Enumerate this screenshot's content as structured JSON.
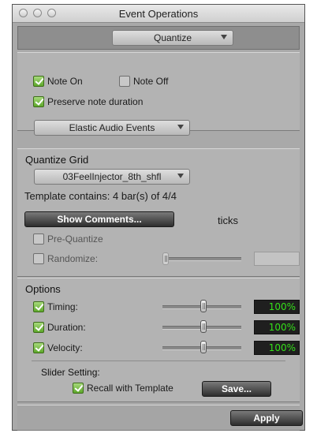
{
  "window": {
    "title": "Event Operations"
  },
  "operation_select": {
    "value": "Quantize"
  },
  "note_options": {
    "note_on": {
      "label": "Note On",
      "checked": true
    },
    "note_off": {
      "label": "Note Off",
      "checked": false
    },
    "preserve_duration": {
      "label": "Preserve note duration",
      "checked": true
    },
    "target_select": {
      "value": "Elastic Audio Events"
    }
  },
  "quantize_grid": {
    "heading": "Quantize Grid",
    "grid_select": {
      "value": "03FeelInjector_8th_shfl"
    },
    "template_info": "Template contains: 4 bar(s) of 4/4",
    "show_comments_label": "Show Comments...",
    "ticks_label": "ticks",
    "pre_quantize": {
      "label": "Pre-Quantize",
      "checked": false
    },
    "randomize": {
      "label": "Randomize:",
      "checked": false,
      "slider_level": 0.0,
      "value": ""
    }
  },
  "options": {
    "heading": "Options",
    "rows": [
      {
        "label": "Timing:",
        "checked": true,
        "value": "100%",
        "slider_level": 1.0
      },
      {
        "label": "Duration:",
        "checked": true,
        "value": "100%",
        "slider_level": 1.0
      },
      {
        "label": "Velocity:",
        "checked": true,
        "value": "100%",
        "slider_level": 1.0
      }
    ],
    "slider_setting_heading": "Slider Setting:",
    "recall_with_template": {
      "label": "Recall with Template",
      "checked": true
    },
    "save_label": "Save..."
  },
  "footer": {
    "apply_label": "Apply"
  },
  "colors": {
    "value_text": "#35e01a",
    "check_green": "#5da82a",
    "panel": "#b3b3b3"
  }
}
